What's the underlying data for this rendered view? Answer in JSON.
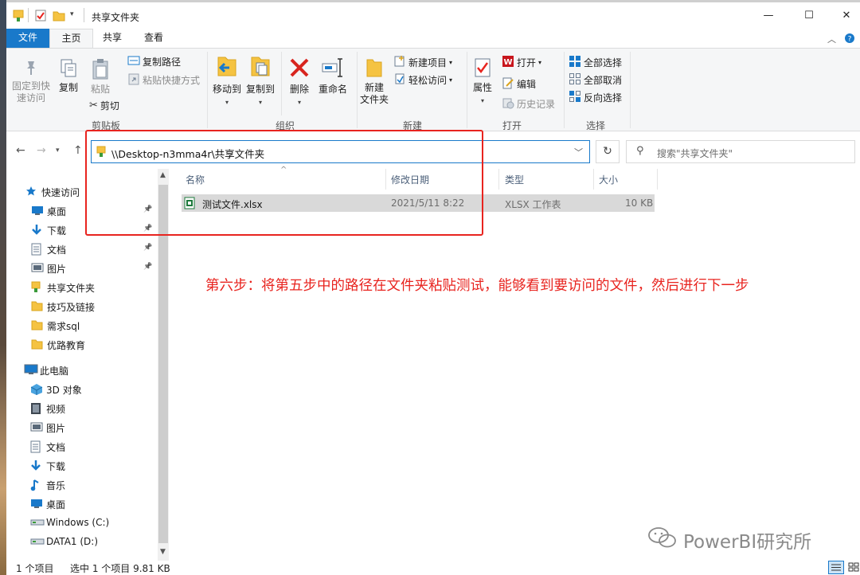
{
  "window": {
    "title": "共享文件夹",
    "controls": {
      "minimize": "—",
      "maximize": "☐",
      "close": "✕"
    }
  },
  "ribbon": {
    "tabs": [
      {
        "label": "文件",
        "active": false
      },
      {
        "label": "主页",
        "active": true
      },
      {
        "label": "共享",
        "active": false
      },
      {
        "label": "查看",
        "active": false
      }
    ],
    "clipboard": {
      "pin_line1": "固定到快",
      "pin_line2": "速访问",
      "copy": "复制",
      "paste": "粘贴",
      "copy_path": "复制路径",
      "paste_shortcut": "粘贴快捷方式",
      "cut": "剪切",
      "group": "剪贴板"
    },
    "organize": {
      "move_to": "移动到",
      "copy_to": "复制到",
      "delete": "删除",
      "rename": "重命名",
      "group": "组织"
    },
    "new": {
      "new_folder_line1": "新建",
      "new_folder_line2": "文件夹",
      "new_item": "新建项目",
      "easy_access": "轻松访问",
      "group": "新建"
    },
    "open": {
      "properties": "属性",
      "open": "打开",
      "edit": "编辑",
      "history": "历史记录",
      "group": "打开"
    },
    "select": {
      "select_all": "全部选择",
      "select_none": "全部取消",
      "invert": "反向选择",
      "group": "选择"
    }
  },
  "address": {
    "path": "\\\\Desktop-n3mma4r\\共享文件夹",
    "search_placeholder": "搜索\"共享文件夹\""
  },
  "nav": {
    "quick_access": "快速访问",
    "items": [
      {
        "label": "桌面",
        "icon": "desktop-icon",
        "pinned": true
      },
      {
        "label": "下载",
        "icon": "download-icon",
        "pinned": true
      },
      {
        "label": "文档",
        "icon": "document-icon",
        "pinned": true
      },
      {
        "label": "图片",
        "icon": "picture-icon",
        "pinned": true
      },
      {
        "label": "共享文件夹",
        "icon": "shared-folder-icon",
        "pinned": false
      },
      {
        "label": "技巧及链接",
        "icon": "folder-icon",
        "pinned": false
      },
      {
        "label": "需求sql",
        "icon": "folder-icon",
        "pinned": false
      },
      {
        "label": "优路教育",
        "icon": "folder-icon",
        "pinned": false
      }
    ],
    "this_pc": "此电脑",
    "pc_items": [
      {
        "label": "3D 对象",
        "icon": "3d-objects-icon"
      },
      {
        "label": "视频",
        "icon": "video-icon"
      },
      {
        "label": "图片",
        "icon": "picture-icon"
      },
      {
        "label": "文档",
        "icon": "document-icon"
      },
      {
        "label": "下载",
        "icon": "download-icon"
      },
      {
        "label": "音乐",
        "icon": "music-icon"
      },
      {
        "label": "桌面",
        "icon": "desktop-icon"
      },
      {
        "label": "Windows (C:)",
        "icon": "drive-icon"
      },
      {
        "label": "DATA1 (D:)",
        "icon": "drive-icon"
      }
    ]
  },
  "file_list": {
    "columns": [
      "名称",
      "修改日期",
      "类型",
      "大小"
    ],
    "rows": [
      {
        "name": "测试文件.xlsx",
        "modified": "2021/5/11 8:22",
        "type": "XLSX 工作表",
        "size": "10 KB"
      }
    ]
  },
  "annotation": "第六步：将第五步中的路径在文件夹粘贴测试，能够看到要访问的文件，然后进行下一步",
  "watermark": "PowerBI研究所",
  "status": {
    "count": "1 个项目",
    "selected": "选中 1 个项目  9.81 KB"
  },
  "colors": {
    "accent": "#1979ca",
    "annotation_red": "#e8241f",
    "folder_yellow": "#f5c342",
    "selected_row": "#d9d9d9"
  }
}
